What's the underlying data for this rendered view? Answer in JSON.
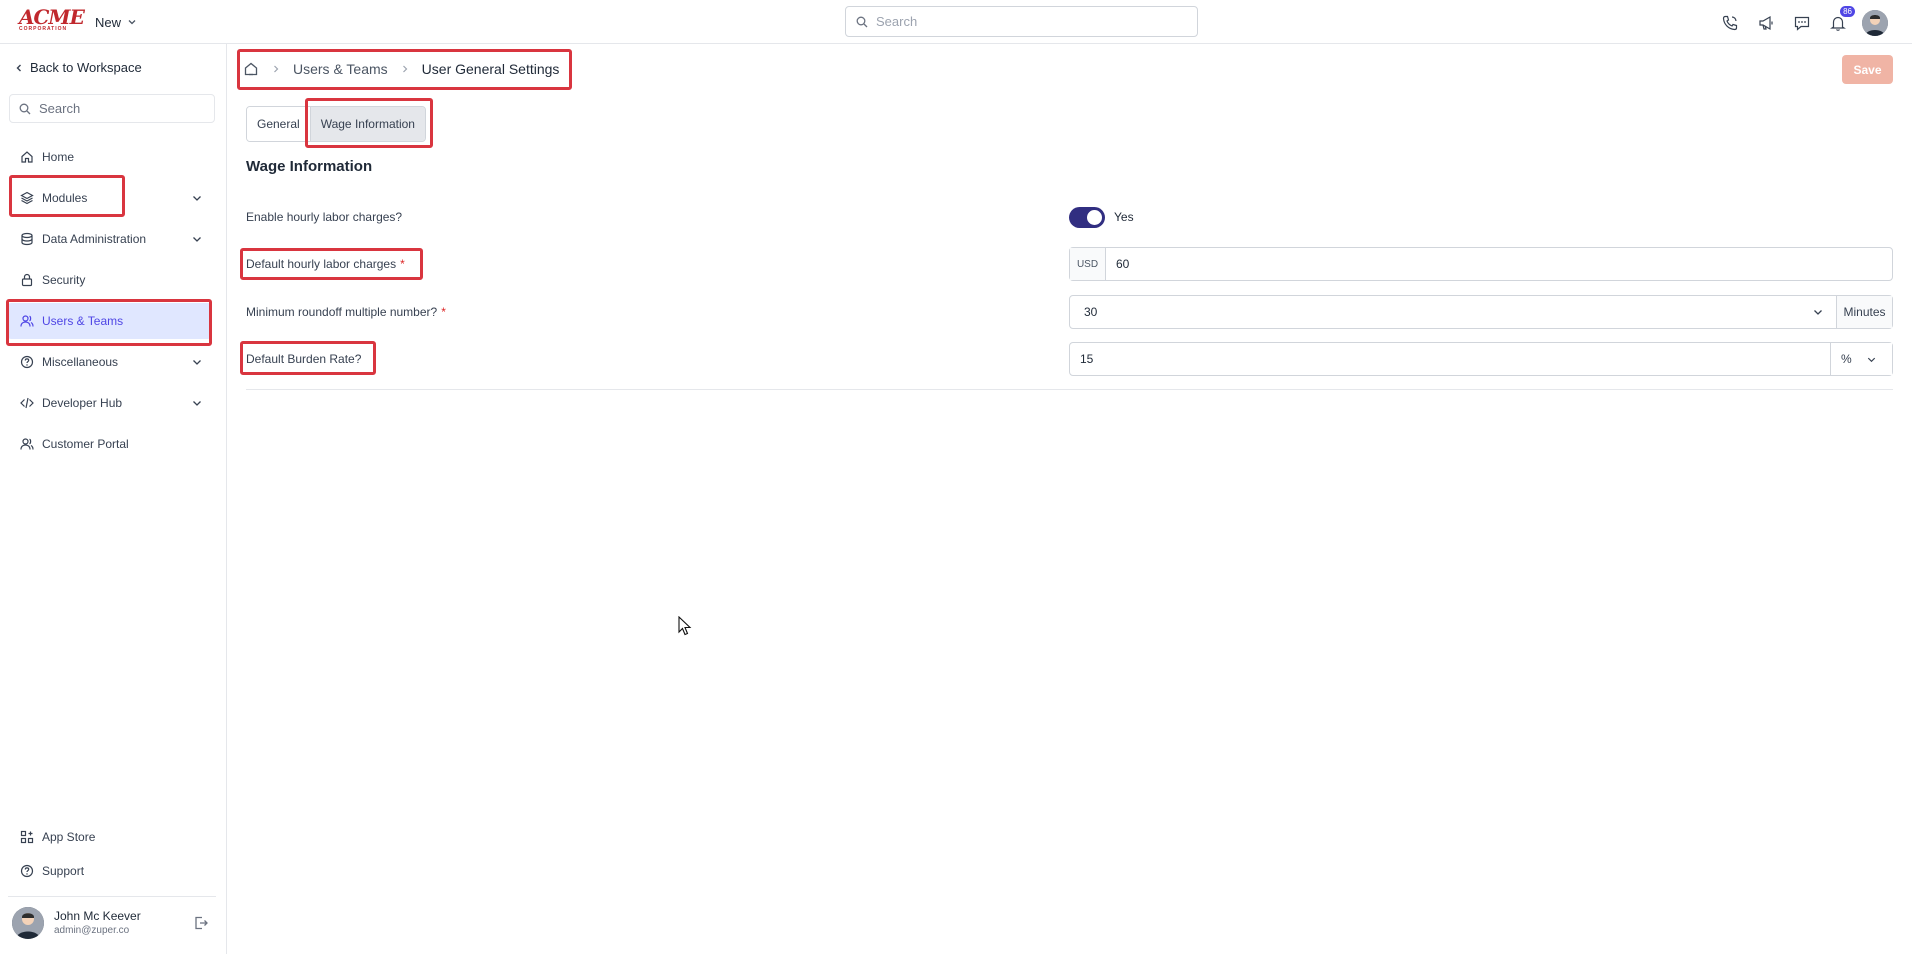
{
  "app": {
    "logo_text": "ACME",
    "logo_subtext": "CORPORATION",
    "new_label": "New",
    "search_placeholder": "Search",
    "notification_count": "86"
  },
  "sidebar": {
    "back_label": "Back to Workspace",
    "search_placeholder": "Search",
    "items": [
      {
        "label": "Home",
        "icon": "home-icon"
      },
      {
        "label": "Modules",
        "icon": "layers-icon",
        "expandable": true
      },
      {
        "label": "Data Administration",
        "icon": "database-icon",
        "expandable": true
      },
      {
        "label": "Security",
        "icon": "lock-icon"
      },
      {
        "label": "Users & Teams",
        "icon": "users-icon",
        "active": true
      },
      {
        "label": "Miscellaneous",
        "icon": "help-circle-icon",
        "expandable": true
      },
      {
        "label": "Developer Hub",
        "icon": "code-icon",
        "expandable": true
      },
      {
        "label": "Customer Portal",
        "icon": "users-icon"
      }
    ],
    "bottom_items": [
      {
        "label": "App Store",
        "icon": "apps-icon"
      },
      {
        "label": "Support",
        "icon": "help-circle-icon"
      }
    ],
    "user": {
      "name": "John Mc Keever",
      "email": "admin@zuper.co"
    }
  },
  "breadcrumb": {
    "parent": "Users & Teams",
    "current": "User General Settings"
  },
  "save_label": "Save",
  "tabs": [
    {
      "label": "General",
      "active": false
    },
    {
      "label": "Wage Information",
      "active": true
    }
  ],
  "section_title": "Wage Information",
  "fields": {
    "hourly_enable": {
      "label": "Enable hourly labor charges?",
      "value_text": "Yes",
      "on": true
    },
    "hourly_charges": {
      "label": "Default hourly labor charges",
      "required": "*",
      "prefix": "USD",
      "value": "60"
    },
    "roundoff": {
      "label": "Minimum roundoff multiple number?",
      "required": "*",
      "value": "30",
      "suffix": "Minutes"
    },
    "burden": {
      "label": "Default Burden Rate?",
      "value": "15",
      "unit": "%"
    }
  },
  "colors": {
    "accent": "#4f46e5",
    "toggle_on": "#312e81",
    "save_disabled": "#f0b4a5",
    "highlight": "#d9353f",
    "logo": "#c0282d"
  }
}
